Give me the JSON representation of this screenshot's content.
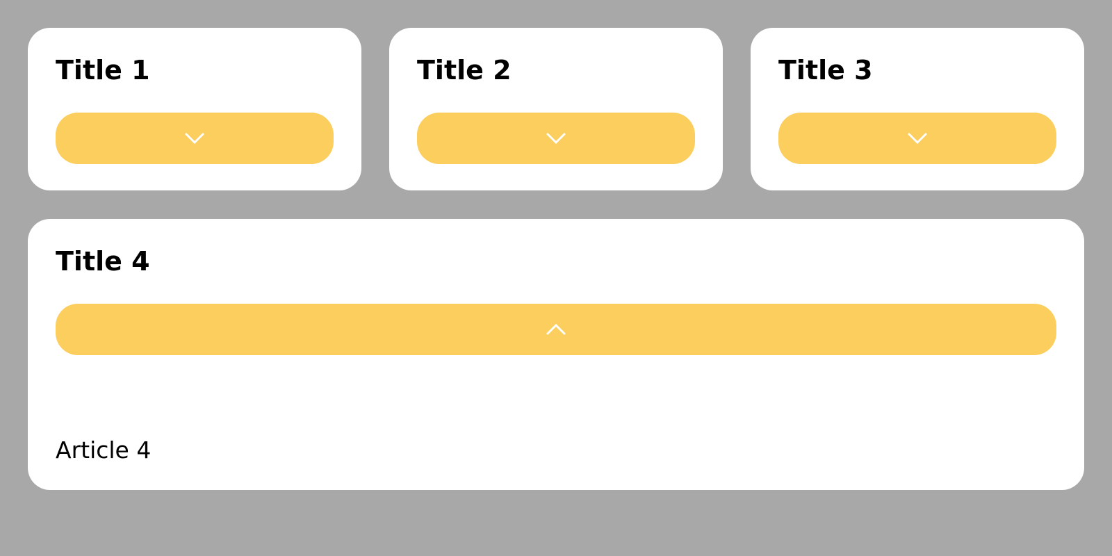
{
  "colors": {
    "background": "#a8a8a8",
    "card": "#ffffff",
    "accent": "#fcce5d",
    "icon": "#ffffff",
    "text": "#000000"
  },
  "cards": [
    {
      "title": "Title 1",
      "toggle_icon": "chevron-down-icon",
      "expanded": false
    },
    {
      "title": "Title 2",
      "toggle_icon": "chevron-down-icon",
      "expanded": false
    },
    {
      "title": "Title 3",
      "toggle_icon": "chevron-down-icon",
      "expanded": false
    },
    {
      "title": "Title 4",
      "toggle_icon": "chevron-up-icon",
      "expanded": true,
      "content": "Article 4"
    }
  ]
}
